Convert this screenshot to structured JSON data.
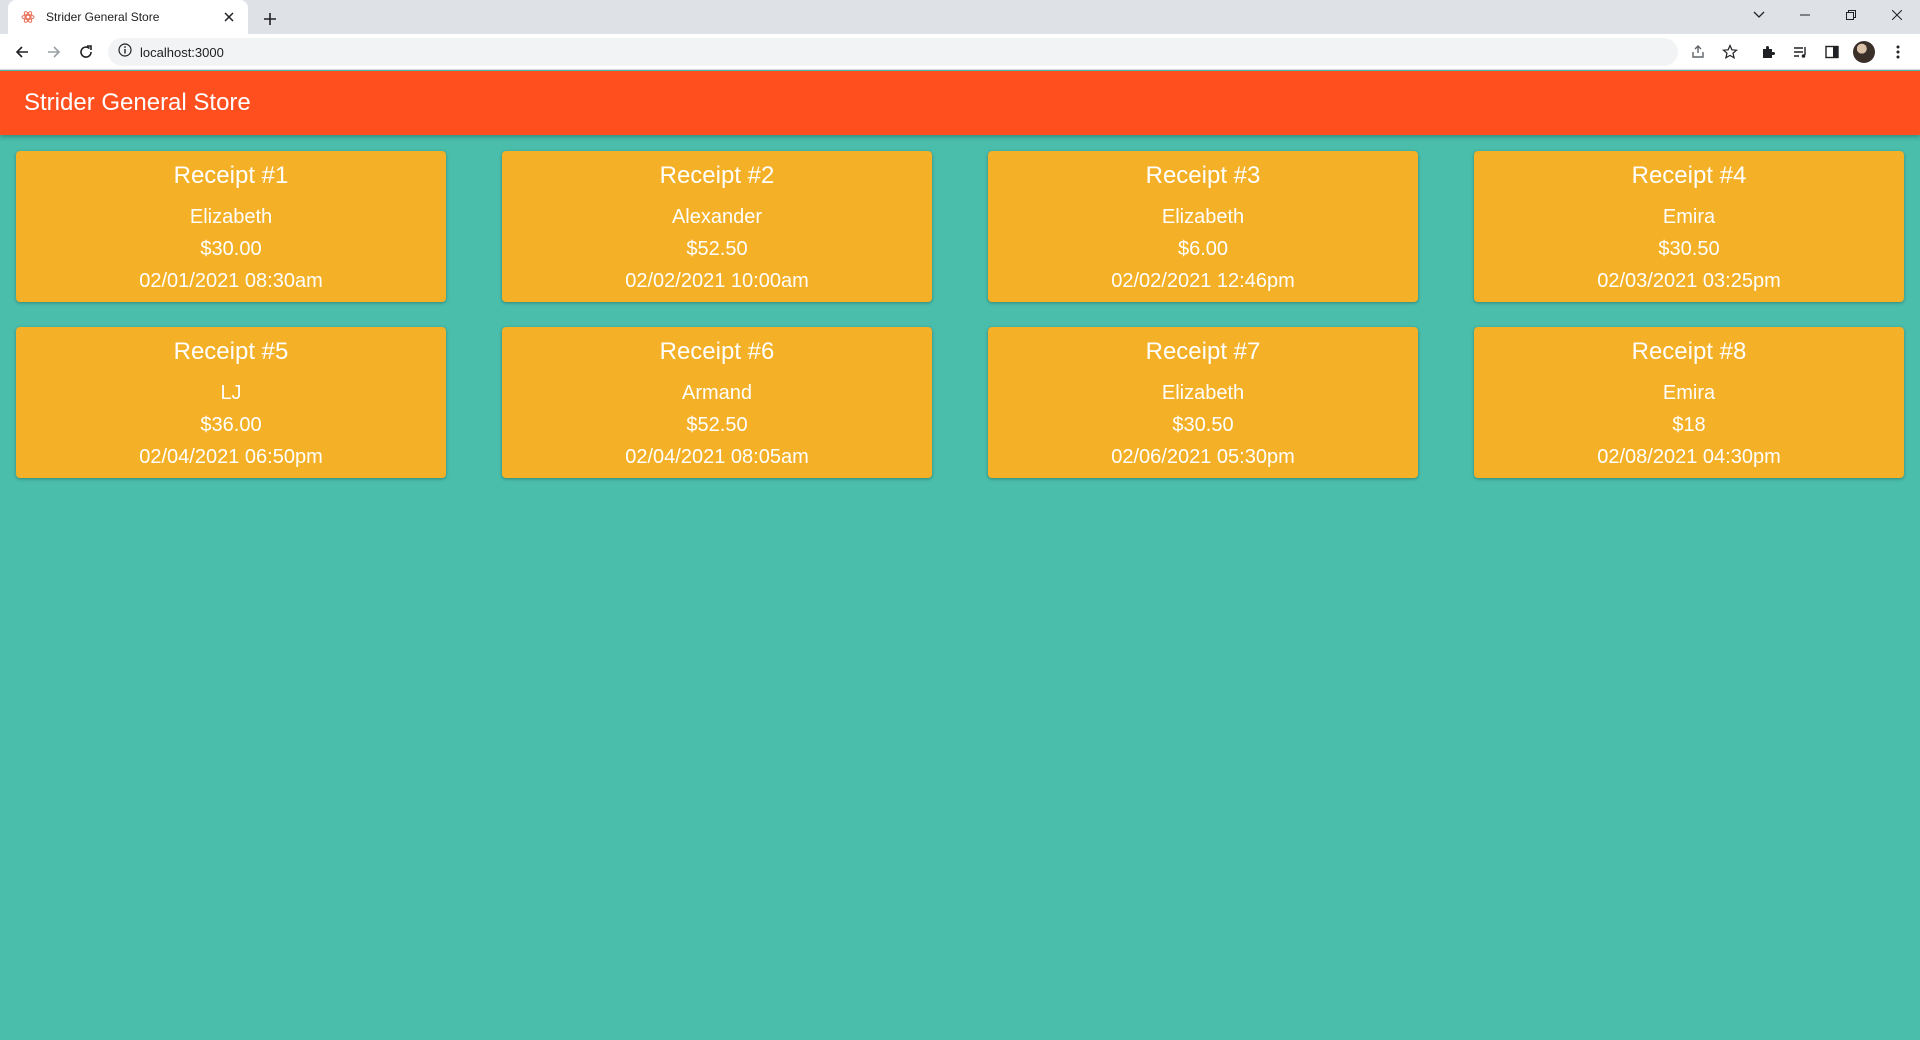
{
  "browser": {
    "tab_title": "Strider General Store",
    "url": "localhost:3000"
  },
  "app": {
    "title": "Strider General Store"
  },
  "receipts": [
    {
      "title": "Receipt #1",
      "customer": "Elizabeth",
      "amount": "$30.00",
      "datetime": "02/01/2021 08:30am"
    },
    {
      "title": "Receipt #2",
      "customer": "Alexander",
      "amount": "$52.50",
      "datetime": "02/02/2021 10:00am"
    },
    {
      "title": "Receipt #3",
      "customer": "Elizabeth",
      "amount": "$6.00",
      "datetime": "02/02/2021 12:46pm"
    },
    {
      "title": "Receipt #4",
      "customer": "Emira",
      "amount": "$30.50",
      "datetime": "02/03/2021 03:25pm"
    },
    {
      "title": "Receipt #5",
      "customer": "LJ",
      "amount": "$36.00",
      "datetime": "02/04/2021 06:50pm"
    },
    {
      "title": "Receipt #6",
      "customer": "Armand",
      "amount": "$52.50",
      "datetime": "02/04/2021 08:05am"
    },
    {
      "title": "Receipt #7",
      "customer": "Elizabeth",
      "amount": "$30.50",
      "datetime": "02/06/2021 05:30pm"
    },
    {
      "title": "Receipt #8",
      "customer": "Emira",
      "amount": "$18",
      "datetime": "02/08/2021 04:30pm"
    }
  ],
  "colors": {
    "page_background": "#4abdab",
    "appbar": "#ff4f1f",
    "card": "#f4b026"
  },
  "icons": [
    "favicon-icon",
    "close-tab-icon",
    "new-tab-icon",
    "tab-search-icon",
    "minimize-icon",
    "restore-icon",
    "close-window-icon",
    "back-icon",
    "forward-icon",
    "reload-icon",
    "site-info-icon",
    "share-icon",
    "bookmark-star-icon",
    "extensions-icon",
    "reading-list-icon",
    "side-panel-icon",
    "profile-avatar",
    "menu-icon"
  ]
}
